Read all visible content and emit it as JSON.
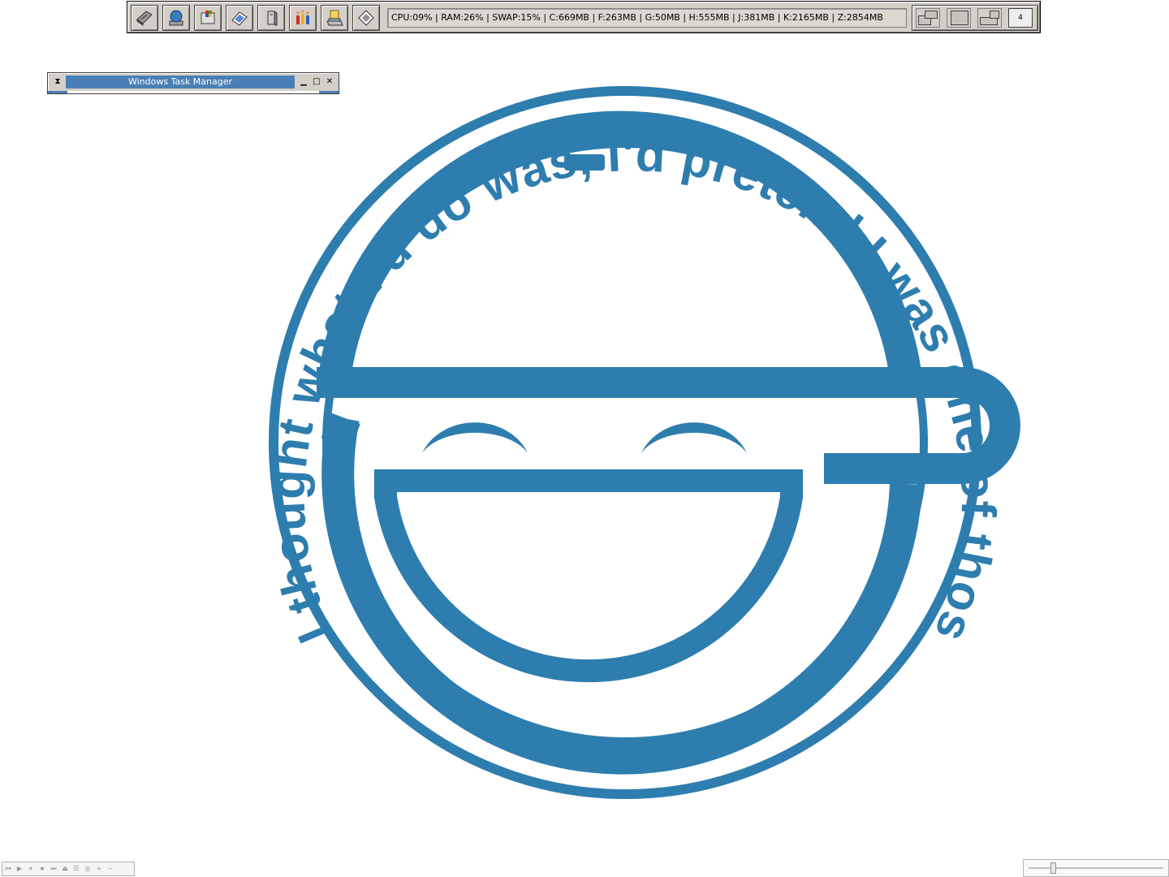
{
  "toolbar": {
    "launchers": [
      {
        "name": "hard-drive-icon"
      },
      {
        "name": "globe-network-icon"
      },
      {
        "name": "windows-flag-icon"
      },
      {
        "name": "notepad-icon"
      },
      {
        "name": "computer-case-icon"
      },
      {
        "name": "users-group-icon"
      },
      {
        "name": "desktop-folder-icon"
      },
      {
        "name": "media-player-icon"
      }
    ],
    "stats": "CPU:09% | RAM:26% | SWAP:15% | C:669MB | F:263MB | G:50MB | H:555MB | J:381MB | K:2165MB | Z:2854MB",
    "pager": {
      "current_desktop_label": "4"
    }
  },
  "taskwin": {
    "title": "Windows Task Manager",
    "sys_icon_glyph": "⧗",
    "minimize_glyph": "▁",
    "maximize_glyph": "□",
    "close_glyph": "✕"
  },
  "logo": {
    "ring_text": "I thought what I'd do was, I'd pretend I was one of those deaf-mutes",
    "color": "#2e7daf"
  },
  "mediabar": {
    "buttons": [
      "⏮",
      "▶",
      "⏸",
      "⏹",
      "⏭",
      "⏏",
      "☰",
      "◎",
      "+",
      "−"
    ]
  },
  "slider": {
    "value_fraction": 0.17
  }
}
